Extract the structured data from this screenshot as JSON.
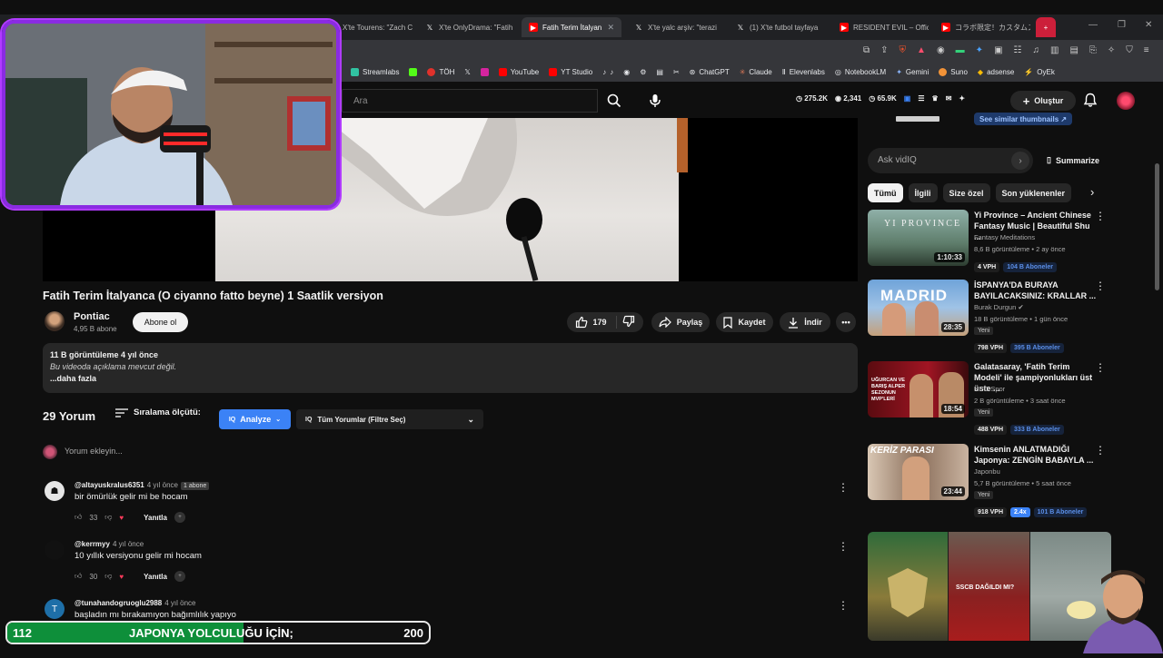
{
  "browser": {
    "tabs": [
      {
        "label": "X'te Tourens: \"Zach Cr",
        "icon": "x-icon"
      },
      {
        "label": "X'te OnlyDrama: \"Fatih",
        "icon": "x-icon"
      },
      {
        "label": "Fatih Terim İtalyan",
        "icon": "youtube-icon",
        "active": true
      },
      {
        "label": "X'te yalc arşiv: \"terazi",
        "icon": "x-icon"
      },
      {
        "label": "(1) X'te futbol tayfaya",
        "icon": "x-icon"
      },
      {
        "label": "RESIDENT EVIL – Offic",
        "icon": "youtube-icon"
      },
      {
        "label": "コラボ限定！カスタムス",
        "icon": "youtube-icon"
      }
    ],
    "bookmarks": [
      "Streamlabs",
      "TÖH",
      "YouTube",
      "YT Studio",
      "ChatGPT",
      "Claude",
      "Elevenlabs",
      "NotebookLM",
      "Gemini",
      "Suno",
      "adsense",
      "OyEk"
    ]
  },
  "header": {
    "search_placeholder": "Ara",
    "stats": [
      "275.2K",
      "2,341",
      "65.9K"
    ],
    "create_label": "Oluştur",
    "similar_label": "See similar thumbnails ↗"
  },
  "video": {
    "title": "Fatih Terim İtalyanca (O ciyanno fatto beyne) 1 Saatlik versiyon",
    "channel": "Pontiac",
    "subscribers": "4,95 B abone",
    "subscribe_label": "Abone ol",
    "likes": "179",
    "share_label": "Paylaş",
    "save_label": "Kaydet",
    "download_label": "İndir",
    "views_date": "11 B görüntüleme  4 yıl önce",
    "description": "Bu videoda açıklama mevcut değil.",
    "more_label": "...daha fazla"
  },
  "comments_section": {
    "count_label": "29 Yorum",
    "sort_label": "Sıralama ölçütü:",
    "analyze_label": "Analyze",
    "filter_label": "Tüm Yorumlar (Filtre Seç)",
    "add_placeholder": "Yorum ekleyin...",
    "reply_label": "Yanıtla",
    "items": [
      {
        "author": "@altayuskralus6351",
        "time": "4 yıl önce",
        "badge": "1 abone",
        "text": "bir ömürlük gelir mi be hocam",
        "likes": "33"
      },
      {
        "author": "@kerrmyy",
        "time": "4 yıl önce",
        "badge": "",
        "text": "10 yıllık versiyonu gelir mi hocam",
        "likes": "30"
      },
      {
        "author": "@tunahandogruoglu2988",
        "time": "4 yıl önce",
        "badge": "",
        "text": "başladın mı bırakamıyon bağımlılık yapıyo",
        "likes": "",
        "avatar_letter": "T"
      }
    ]
  },
  "sidebar": {
    "vidiq_placeholder": "Ask vidIQ",
    "summarize_label": "Summarize",
    "chips": [
      "Tümü",
      "İlgili",
      "Size özel",
      "Son yüklenenler"
    ],
    "recommendations": [
      {
        "title": "Yi Province – Ancient Chinese Fantasy Music | Beautiful Shu ...",
        "channel": "Fantasy Meditations",
        "meta": "8,6 B görüntüleme • 2 ay önce",
        "duration": "1:10:33",
        "vph": "4 VPH",
        "subs": "104 B Aboneler",
        "thumb_text": "YI PROVINCE",
        "is_new": ""
      },
      {
        "title": "İSPANYA'DA BURAYA BAYILACAKSINIZ: KRALLAR ...",
        "channel": "Burak Durgun",
        "meta": "18 B görüntüleme • 1 gün önce",
        "duration": "28:35",
        "vph": "798 VPH",
        "subs": "395 B Aboneler",
        "thumb_text": "MADRID",
        "is_new": "Yeni"
      },
      {
        "title": "Galatasaray, 'Fatih Terim Modeli' ile şampiyonlukları üst üste ...",
        "channel": "NEO Spor",
        "meta": "2 B görüntüleme • 3 saat önce",
        "duration": "18:54",
        "vph": "488 VPH",
        "subs": "333 B Aboneler",
        "thumb_text": "UĞURCAN VE BARIŞ ALPER SEZONUN MVP'LERİ",
        "is_new": "Yeni"
      },
      {
        "title": "Kimsenin ANLATMADIĞI Japonya: ZENGİN BABAYLA ...",
        "channel": "Japonbu",
        "meta": "5,7 B görüntüleme • 5 saat önce",
        "duration": "23:44",
        "vph": "918 VPH",
        "mult": "2.4x",
        "subs": "101 B Aboneler",
        "thumb_text": "KERİZ PARASI",
        "is_new": "Yeni"
      }
    ],
    "bottom_thumb_text": "SSCB DAĞILDI MI?"
  },
  "goal_overlay": {
    "current": "112",
    "label": "JAPONYA YOLCULUĞU İÇİN;",
    "target": "200",
    "progress_fraction": 0.56
  },
  "colors": {
    "accent": "#3b82f6",
    "youtube_red": "#ff0000",
    "webcam_border": "#8a2be2",
    "goal_green": "#0e8f3a"
  }
}
